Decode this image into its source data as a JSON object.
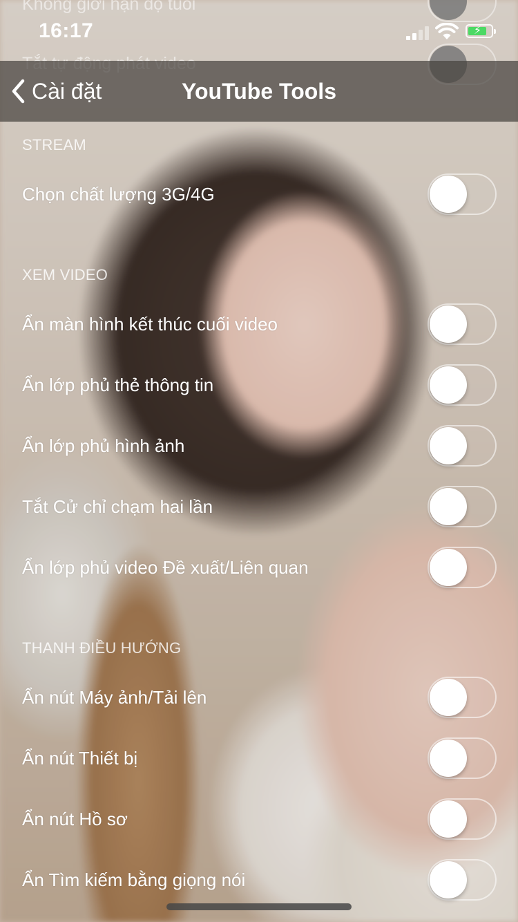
{
  "status_bar": {
    "time": "16:17",
    "signal_icon": "cellular-signal-icon",
    "wifi_icon": "wifi-icon",
    "battery_icon": "battery-charging-icon",
    "battery_color": "#4cd964"
  },
  "nav": {
    "back_label": "Cài đặt",
    "back_icon": "chevron-left-icon",
    "title": "YouTube Tools"
  },
  "scrolled_rows": [
    {
      "label": "Không giới hạn độ tuổi"
    },
    {
      "label": "Tắt tự động phát video"
    }
  ],
  "sections": [
    {
      "header": "STREAM",
      "rows": [
        {
          "label": "Chọn chất lượng 3G/4G",
          "on": false
        }
      ]
    },
    {
      "header": "XEM VIDEO",
      "rows": [
        {
          "label": "Ẩn màn hình kết thúc cuối video",
          "on": false
        },
        {
          "label": "Ẩn lớp phủ thẻ thông tin",
          "on": false
        },
        {
          "label": "Ẩn lớp phủ hình ảnh",
          "on": false
        },
        {
          "label": "Tắt Cử chỉ chạm hai lần",
          "on": false
        },
        {
          "label": "Ẩn lớp phủ video Đề xuất/Liên quan",
          "on": false
        }
      ]
    },
    {
      "header": "THANH ĐIỀU HƯỚNG",
      "rows": [
        {
          "label": "Ẩn nút Máy ảnh/Tải lên",
          "on": false
        },
        {
          "label": "Ẩn nút Thiết bị",
          "on": false
        },
        {
          "label": "Ẩn nút Hồ sơ",
          "on": false
        },
        {
          "label": "Ẩn Tìm kiếm bằng giọng nói",
          "on": false
        }
      ]
    }
  ]
}
